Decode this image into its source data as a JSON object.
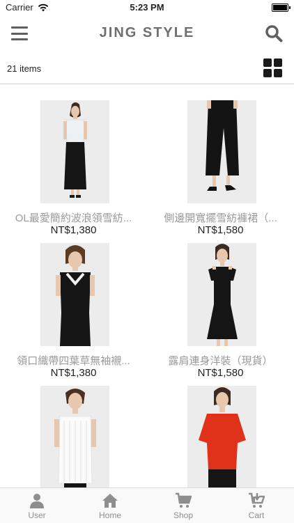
{
  "status_bar": {
    "carrier": "Carrier",
    "time": "5:23 PM"
  },
  "header": {
    "title": "JING STYLE"
  },
  "list": {
    "count_text": "21 items"
  },
  "products": [
    {
      "name": "OL最愛簡約波浪領雪紡...",
      "price": "NT$1,380"
    },
    {
      "name": "側邊開寬擺雪紡褲裙（...",
      "price": "NT$1,580"
    },
    {
      "name": "領口織帶四葉草無袖襯...",
      "price": "NT$1,380"
    },
    {
      "name": "露肩連身洋裝（現貨）",
      "price": "NT$1,580"
    },
    {
      "name": "",
      "price": ""
    },
    {
      "name": "",
      "price": ""
    }
  ],
  "tabs": [
    {
      "label": "User",
      "icon": "user-icon"
    },
    {
      "label": "Home",
      "icon": "home-icon"
    },
    {
      "label": "Shop",
      "icon": "cart-icon"
    },
    {
      "label": "Cart",
      "icon": "cart-download-icon"
    }
  ],
  "colors": {
    "accent_gray": "#6f6f6f",
    "tab_gray": "#8e8e8e",
    "red_top": "#e0321a"
  }
}
